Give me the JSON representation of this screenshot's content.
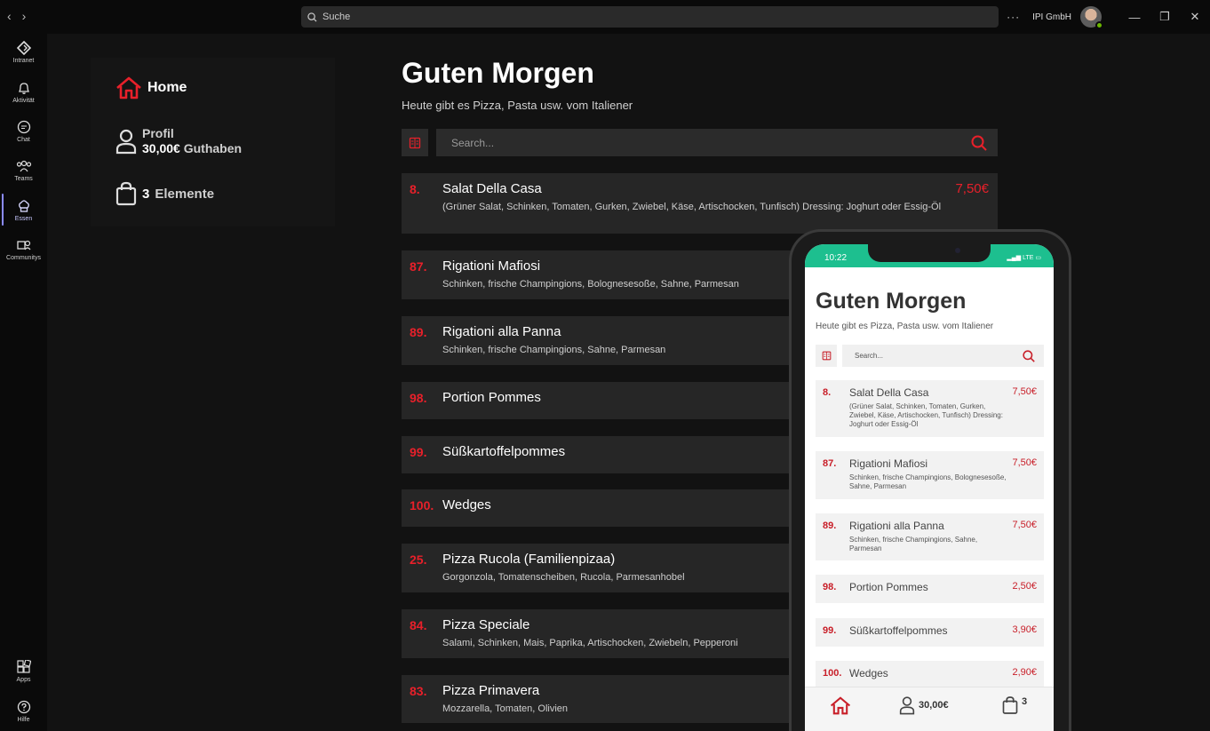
{
  "titlebar": {
    "search_placeholder": "Suche",
    "org_name": "IPI GmbH",
    "more": "···",
    "minimize": "—",
    "maximize": "❐",
    "close": "✕"
  },
  "rail": {
    "items": [
      {
        "label": "Intranet",
        "icon": "intranet-icon"
      },
      {
        "label": "Aktivität",
        "icon": "bell-icon"
      },
      {
        "label": "Chat",
        "icon": "chat-icon"
      },
      {
        "label": "Teams",
        "icon": "teams-icon"
      },
      {
        "label": "Essen",
        "icon": "chef-hat-icon",
        "active": true
      },
      {
        "label": "Communitys",
        "icon": "communities-icon"
      }
    ],
    "bottom": [
      {
        "label": "Apps",
        "icon": "apps-icon"
      },
      {
        "label": "Hilfe",
        "icon": "help-icon"
      }
    ]
  },
  "sidebar": {
    "home_label": "Home",
    "profil_label": "Profil",
    "balance": "30,00€",
    "balance_label": "Guthaben",
    "cart_count": "3",
    "cart_label": "Elemente"
  },
  "main": {
    "title": "Guten Morgen",
    "subtitle": "Heute gibt es Pizza, Pasta usw. vom Italiener",
    "search_placeholder": "Search...",
    "items": [
      {
        "num": "8.",
        "name": "Salat Della Casa",
        "desc": "(Grüner Salat, Schinken, Tomaten, Gurken, Zwiebel, Käse, Artischocken, Tunfisch) Dressing: Joghurt oder Essig-Öl",
        "price": "7,50€"
      },
      {
        "num": "87.",
        "name": "Rigationi Mafiosi",
        "desc": "Schinken, frische Champingions, Bolognesesoße, Sahne, Parmesan",
        "price": ""
      },
      {
        "num": "89.",
        "name": "Rigationi alla Panna",
        "desc": "Schinken, frische Champingions, Sahne, Parmesan",
        "price": ""
      },
      {
        "num": "98.",
        "name": "Portion Pommes",
        "desc": "",
        "price": ""
      },
      {
        "num": "99.",
        "name": "Süßkartoffelpommes",
        "desc": "",
        "price": ""
      },
      {
        "num": "100.",
        "name": "Wedges",
        "desc": "",
        "price": ""
      },
      {
        "num": "25.",
        "name": "Pizza Rucola (Familienpizaa)",
        "desc": "Gorgonzola, Tomatenscheiben, Rucola, Parmesanhobel",
        "price": ""
      },
      {
        "num": "84.",
        "name": "Pizza Speciale",
        "desc": "Salami, Schinken, Mais, Paprika, Artischocken, Zwiebeln, Pepperoni",
        "price": ""
      },
      {
        "num": "83.",
        "name": "Pizza Primavera",
        "desc": "Mozzarella, Tomaten, Olivien",
        "price": ""
      }
    ]
  },
  "phone": {
    "time": "10:22",
    "signal": "LTE",
    "title": "Guten Morgen",
    "subtitle": "Heute gibt es Pizza, Pasta usw. vom Italiener",
    "search_placeholder": "Search...",
    "items": [
      {
        "num": "8.",
        "name": "Salat Della Casa",
        "desc": "(Grüner Salat, Schinken, Tomaten, Gurken, Zwiebel, Käse, Artischocken, Tunfisch) Dressing: Joghurt oder Essig-Öl",
        "price": "7,50€"
      },
      {
        "num": "87.",
        "name": "Rigationi Mafiosi",
        "desc": "Schinken, frische Champingions, Bolognesesoße, Sahne, Parmesan",
        "price": "7,50€"
      },
      {
        "num": "89.",
        "name": "Rigationi alla Panna",
        "desc": "Schinken, frische Champingions, Sahne, Parmesan",
        "price": "7,50€"
      },
      {
        "num": "98.",
        "name": "Portion Pommes",
        "desc": "",
        "price": "2,50€"
      },
      {
        "num": "99.",
        "name": "Süßkartoffelpommes",
        "desc": "",
        "price": "3,90€"
      },
      {
        "num": "100.",
        "name": "Wedges",
        "desc": "",
        "price": "2,90€"
      }
    ],
    "nav": {
      "balance": "30,00€",
      "cart_count": "3"
    }
  },
  "colors": {
    "accent": "#e8202a",
    "phone_status": "#1dbf8f",
    "rail_active": "#8b8bff"
  }
}
